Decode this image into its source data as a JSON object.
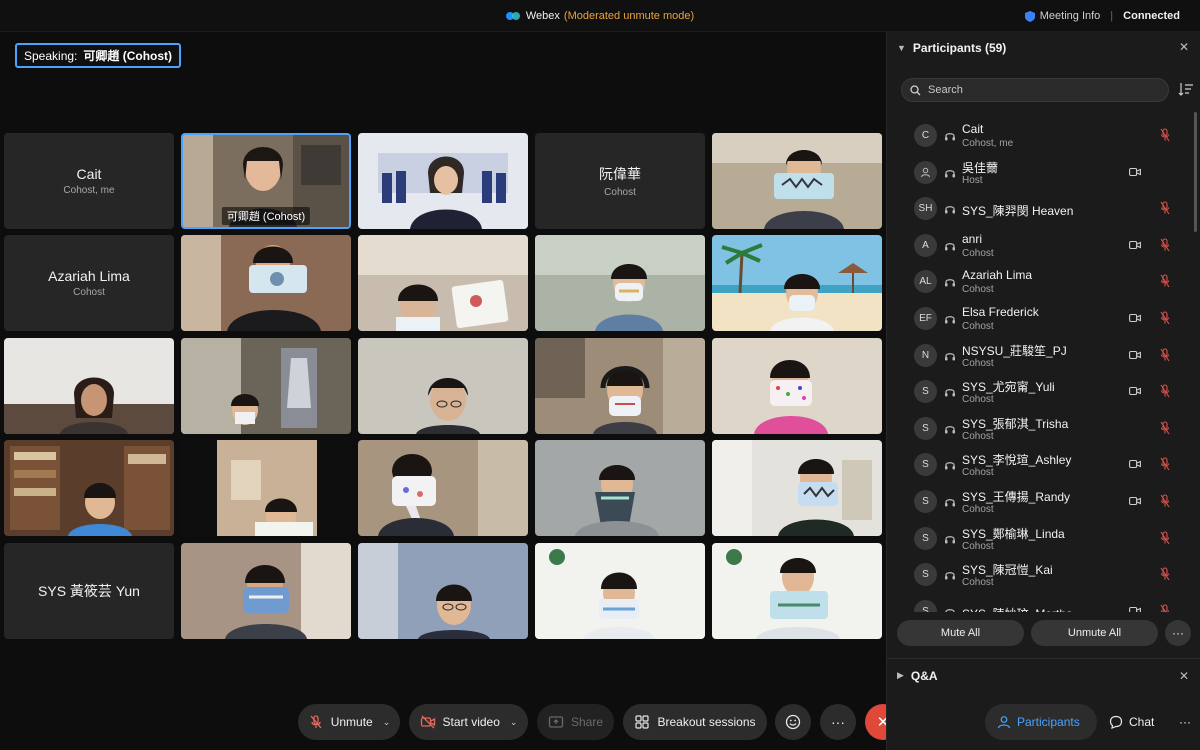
{
  "window": {
    "app_name": "Webex",
    "mode": "(Moderated unmute mode)",
    "meeting_info": "Meeting Info",
    "separator": "|",
    "status": "Connected"
  },
  "speaking": {
    "label": "Speaking:",
    "name": "可卿趙 (Cohost)"
  },
  "grid": {
    "name_tiles": [
      {
        "name": "Cait",
        "role": "Cohost, me"
      },
      {
        "name": "阮偉華",
        "role": "Cohost"
      },
      {
        "name": "Azariah Lima",
        "role": "Cohost"
      },
      {
        "name": "SYS 黃筱芸 Yun",
        "role": ""
      }
    ],
    "active_caption": "可卿趙  (Cohost)"
  },
  "toolbar": {
    "unmute": "Unmute",
    "start_video": "Start video",
    "share": "Share",
    "breakout": "Breakout sessions",
    "reactions_icon": "smiley-icon",
    "more": "···",
    "end": "✕",
    "caret": "⌄"
  },
  "panel": {
    "title": "Participants (59)",
    "close": "✕",
    "search_placeholder": "Search",
    "participants": [
      {
        "initials": "C",
        "name": "Cait",
        "role": "Cohost, me",
        "video": false,
        "muted": true
      },
      {
        "initials": "",
        "name": "吳佳薾",
        "role": "Host",
        "video": true,
        "muted": false
      },
      {
        "initials": "SH",
        "name": "SYS_陳羿閔 Heaven",
        "role": "",
        "video": false,
        "muted": true
      },
      {
        "initials": "A",
        "name": "anri",
        "role": "Cohost",
        "video": true,
        "muted": true
      },
      {
        "initials": "AL",
        "name": "Azariah Lima",
        "role": "Cohost",
        "video": false,
        "muted": true
      },
      {
        "initials": "EF",
        "name": "Elsa Frederick",
        "role": "Cohost",
        "video": true,
        "muted": true
      },
      {
        "initials": "N",
        "name": "NSYSU_莊駿笙_PJ",
        "role": "Cohost",
        "video": true,
        "muted": true
      },
      {
        "initials": "S",
        "name": "SYS_尤宛甯_Yuli",
        "role": "Cohost",
        "video": true,
        "muted": true
      },
      {
        "initials": "S",
        "name": "SYS_張郁淇_Trisha",
        "role": "Cohost",
        "video": false,
        "muted": true
      },
      {
        "initials": "S",
        "name": "SYS_李悅瑄_Ashley",
        "role": "Cohost",
        "video": true,
        "muted": true
      },
      {
        "initials": "S",
        "name": "SYS_王傳揚_Randy",
        "role": "Cohost",
        "video": true,
        "muted": true
      },
      {
        "initials": "S",
        "name": "SYS_鄭榆琳_Linda",
        "role": "Cohost",
        "video": false,
        "muted": true
      },
      {
        "initials": "S",
        "name": "SYS_陳冠愷_Kai",
        "role": "Cohost",
        "video": false,
        "muted": true
      },
      {
        "initials": "S",
        "name": "SYS_陳妙玟_Martha",
        "role": "",
        "video": true,
        "muted": true
      }
    ],
    "mute_all": "Mute All",
    "unmute_all": "Unmute All",
    "more": "···",
    "qa_title": "Q&A",
    "tabs": {
      "participants": "Participants",
      "chat": "Chat",
      "more": "···"
    }
  },
  "colors": {
    "accent": "#4aa3ff",
    "warning": "#e8a33b",
    "end_call": "#e0483a",
    "muted": "#d9534f"
  }
}
